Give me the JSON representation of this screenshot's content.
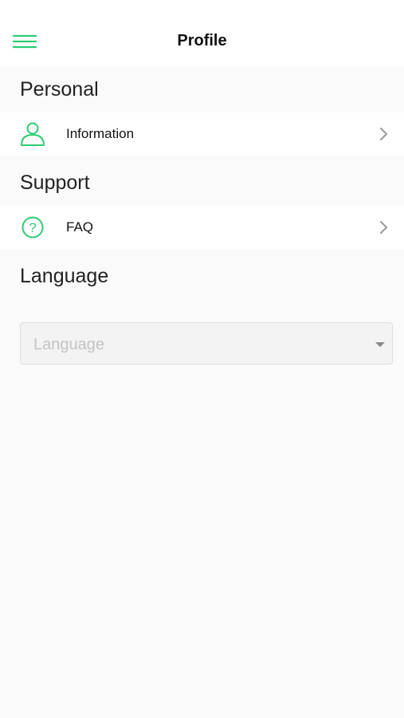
{
  "header": {
    "title": "Profile",
    "menu_icon": "hamburger-menu-icon"
  },
  "sections": {
    "personal": {
      "title": "Personal",
      "item": {
        "label": "Information",
        "icon": "user-icon"
      }
    },
    "support": {
      "title": "Support",
      "item": {
        "label": "FAQ",
        "icon": "help-circle-icon"
      }
    },
    "language": {
      "title": "Language",
      "select": {
        "placeholder": "Language",
        "value": ""
      }
    }
  },
  "colors": {
    "accent": "#2ecc71",
    "background": "#fafafa",
    "card": "#ffffff",
    "chevron": "#9a9a9a",
    "placeholder": "#c4c4c4"
  }
}
